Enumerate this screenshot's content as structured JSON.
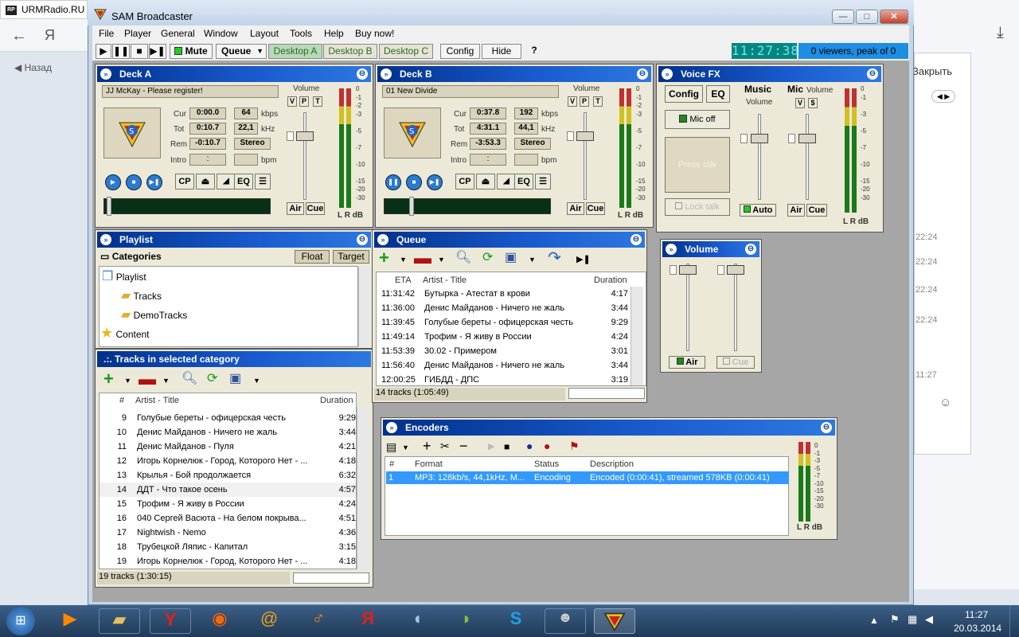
{
  "browser": {
    "tab_title": "URMRadio.RU",
    "back_label": "Назад",
    "close_label": "Закрыть",
    "times": [
      "22:24",
      "22:24",
      "22:24",
      "22:24",
      "11:27"
    ]
  },
  "window": {
    "title": "SAM Broadcaster",
    "menu": [
      "File",
      "Player",
      "General",
      "Window",
      "Layout",
      "Tools",
      "Help",
      "Buy now!"
    ],
    "toolbar": {
      "mute": "Mute",
      "queue": "Queue",
      "desktops": [
        "Desktop A",
        "Desktop B",
        "Desktop C"
      ],
      "config": "Config",
      "hide": "Hide",
      "help": "?"
    },
    "clock": "11:27:38",
    "viewers": "0 viewers, peak of 0"
  },
  "deck_a": {
    "title": "Deck A",
    "track": "JJ McKay - Please register!",
    "labels": {
      "cur": "Cur",
      "tot": "Tot",
      "rem": "Rem",
      "intro": "Intro",
      "kbps": "kbps",
      "khz": "kHz",
      "bpm": "bpm",
      "volume": "Volume"
    },
    "cur": "0:00.0",
    "tot": "0:10.7",
    "rem": "-0:10.7",
    "intro": ":",
    "bitrate": "64",
    "samplerate": "22,1",
    "mode": "Stereo",
    "buttons": {
      "cp": "CP",
      "eq": "EQ",
      "air": "Air",
      "cue": "Cue",
      "v": "V",
      "p": "P",
      "t": "T"
    }
  },
  "deck_b": {
    "title": "Deck B",
    "track": "01 New Divide",
    "labels": {
      "cur": "Cur",
      "tot": "Tot",
      "rem": "Rem",
      "intro": "Intro",
      "kbps": "kbps",
      "khz": "kHz",
      "bpm": "bpm",
      "volume": "Volume"
    },
    "cur": "0:37.8",
    "tot": "4:31.1",
    "rem": "-3:53.3",
    "intro": ":",
    "bitrate": "192",
    "samplerate": "44,1",
    "mode": "Stereo",
    "buttons": {
      "cp": "CP",
      "eq": "EQ",
      "air": "Air",
      "cue": "Cue",
      "v": "V",
      "p": "P",
      "t": "T"
    }
  },
  "vu_scale": [
    "0",
    "-1",
    "-2",
    "-3",
    "-5",
    "-7",
    "-10",
    "-15",
    "-20",
    "-30"
  ],
  "vu_footer": "L R dB",
  "voice_fx": {
    "title": "Voice FX",
    "config": "Config",
    "eq": "EQ",
    "music": "Music",
    "music_volume": "Volume",
    "mic": "Mic",
    "mic_volume": "Volume",
    "v": "V",
    "dollar": "$",
    "mic_off": "Mic off",
    "press_talk": "Press talk",
    "lock_talk": "Lock talk",
    "auto": "Auto",
    "air": "Air",
    "cue": "Cue"
  },
  "volume": {
    "title": "Volume",
    "air": "Air",
    "cue": "Cue"
  },
  "playlist": {
    "title": "Playlist",
    "categories": "Categories",
    "float": "Float",
    "target": "Target",
    "tree": [
      {
        "label": "Playlist",
        "level": 0
      },
      {
        "label": "Tracks",
        "level": 1
      },
      {
        "label": "DemoTracks",
        "level": 1
      },
      {
        "label": "Content",
        "level": 0
      }
    ]
  },
  "tracks": {
    "title": ".:. Tracks in selected category",
    "columns": [
      "#",
      "Artist - Title",
      "Duration"
    ],
    "rows": [
      {
        "n": "9",
        "title": "Голубые береты - офицерская честь",
        "dur": "9:29"
      },
      {
        "n": "10",
        "title": "Денис Майданов - Ничего не жаль",
        "dur": "3:44"
      },
      {
        "n": "11",
        "title": "Денис Майданов - Пуля",
        "dur": "4:21"
      },
      {
        "n": "12",
        "title": "Игорь Корнелюк - Город, Которого Нет - ...",
        "dur": "4:18"
      },
      {
        "n": "13",
        "title": "Крылья - Бой продолжается",
        "dur": "6:32"
      },
      {
        "n": "14",
        "title": "ДДТ - Что такое осень",
        "dur": "4:57"
      },
      {
        "n": "15",
        "title": "Трофим - Я живу в России",
        "dur": "4:24"
      },
      {
        "n": "16",
        "title": "040 Сергей Васюта - На белом покрыва...",
        "dur": "4:51"
      },
      {
        "n": "17",
        "title": "Nightwish - Nemo",
        "dur": "4:36"
      },
      {
        "n": "18",
        "title": "Трубецкой Ляпис - Капитал",
        "dur": "3:15"
      },
      {
        "n": "19",
        "title": "Игорь Корнелюк - Город, Которого Нет - ...",
        "dur": "4:18"
      }
    ],
    "status": "19 tracks (1:30:15)"
  },
  "queue": {
    "title": "Queue",
    "columns": [
      "ETA",
      "Artist - Title",
      "Duration"
    ],
    "rows": [
      {
        "eta": "11:31:42",
        "title": "Бутырка - Атестат в крови",
        "dur": "4:17"
      },
      {
        "eta": "11:36:00",
        "title": "Денис Майданов - Ничего не жаль",
        "dur": "3:44"
      },
      {
        "eta": "11:39:45",
        "title": "Голубые береты - офицерская честь",
        "dur": "9:29"
      },
      {
        "eta": "11:49:14",
        "title": "Трофим - Я живу в России",
        "dur": "4:24"
      },
      {
        "eta": "11:53:39",
        "title": "30.02 - Примером",
        "dur": "3:01"
      },
      {
        "eta": "11:56:40",
        "title": "Денис Майданов - Ничего не жаль",
        "dur": "3:44"
      },
      {
        "eta": "12:00:25",
        "title": "ГИБДД - ДПС",
        "dur": "3:19"
      }
    ],
    "status": "14 tracks (1:05:49)"
  },
  "encoders": {
    "title": "Encoders",
    "columns": [
      "#",
      "Format",
      "Status",
      "Description"
    ],
    "rows": [
      {
        "n": "1",
        "format": "MP3: 128kb/s, 44,1kHz, M...",
        "status": "Encoding",
        "desc": "Encoded (0:00:41), streamed 578KB (0:00:41)"
      }
    ]
  },
  "taskbar": {
    "time": "11:27",
    "date": "20.03.2014"
  },
  "colors": {
    "panel_title": "#00318c",
    "clock_bg": "#04887e",
    "viewers_bg": "#1d8ee3",
    "selected_row": "#3399ff",
    "workarea": "#a6a6a6"
  }
}
